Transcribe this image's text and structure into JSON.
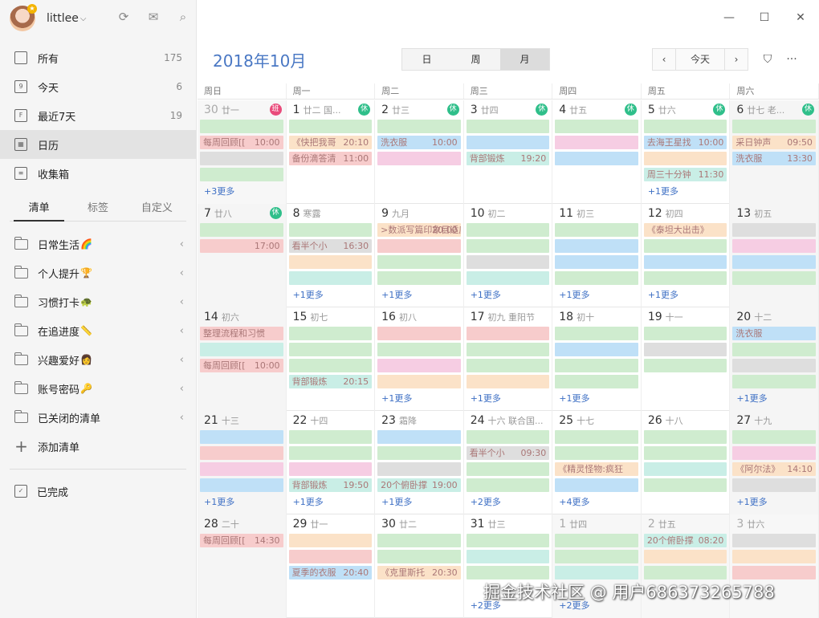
{
  "user": {
    "name": "littlee"
  },
  "nav": [
    {
      "label": "所有",
      "count": "175",
      "icon": "inbox-all-icon"
    },
    {
      "label": "今天",
      "count": "6",
      "icon": "calendar-today-icon"
    },
    {
      "label": "最近7天",
      "count": "19",
      "icon": "calendar-week-icon"
    },
    {
      "label": "日历",
      "count": "",
      "icon": "calendar-icon"
    },
    {
      "label": "收集箱",
      "count": "",
      "icon": "inbox-icon"
    }
  ],
  "list_tabs": [
    "清单",
    "标签",
    "自定义"
  ],
  "lists": [
    {
      "label": "日常生活",
      "emoji": "🌈"
    },
    {
      "label": "个人提升",
      "emoji": "🏆"
    },
    {
      "label": "习惯打卡",
      "emoji": "🐢"
    },
    {
      "label": "在追进度",
      "emoji": "📏"
    },
    {
      "label": "兴趣爱好",
      "emoji": "👩"
    },
    {
      "label": "账号密码",
      "emoji": "🔑"
    },
    {
      "label": "已关闭的清单",
      "emoji": ""
    }
  ],
  "add_list": "添加清单",
  "completed": "已完成",
  "header": {
    "month": "2018年10月",
    "views": [
      "日",
      "周",
      "月"
    ],
    "active_view": "月",
    "today": "今天",
    "prev": "‹",
    "next": "›"
  },
  "weekdays": [
    "周日",
    "周一",
    "周二",
    "周三",
    "周四",
    "周五",
    "周六"
  ],
  "colors": {
    "green": "#cfeccf",
    "red": "#f7cccc",
    "blue": "#bfe0f7",
    "pink": "#f6cde3",
    "orange": "#fbe2c8",
    "gray": "#dedede",
    "teal": "#c9eee6",
    "accent": "#4a78c4"
  },
  "weeks": [
    [
      {
        "num": "30",
        "lunar": "廿一",
        "badge": "班",
        "badge_type": "work",
        "other": true,
        "events": [
          {
            "text": "",
            "time": "",
            "color": "green"
          },
          {
            "text": "每周回顾[[",
            "time": "10:00",
            "color": "red"
          },
          {
            "text": "",
            "time": "",
            "color": "gray"
          },
          {
            "text": "",
            "time": "",
            "color": "green"
          }
        ],
        "more": "+3更多"
      },
      {
        "num": "1",
        "lunar": "廿二 国...",
        "badge": "休",
        "badge_type": "rest",
        "events": [
          {
            "text": "",
            "time": "",
            "color": "green"
          },
          {
            "text": "《快把我哥",
            "time": "20:10",
            "color": "orange"
          },
          {
            "text": "备份滴答清",
            "time": "11:00",
            "color": "red"
          }
        ]
      },
      {
        "num": "2",
        "lunar": "廿三",
        "badge": "休",
        "badge_type": "rest",
        "events": [
          {
            "text": "",
            "time": "",
            "color": "green"
          },
          {
            "text": "洗衣服",
            "time": "10:00",
            "color": "blue"
          },
          {
            "text": "",
            "time": "",
            "color": "pink"
          }
        ]
      },
      {
        "num": "3",
        "lunar": "廿四",
        "badge": "休",
        "badge_type": "rest",
        "events": [
          {
            "text": "",
            "time": "",
            "color": "green"
          },
          {
            "text": "",
            "time": "",
            "color": "blue"
          },
          {
            "text": "背部锻炼",
            "time": "19:20",
            "color": "teal"
          }
        ]
      },
      {
        "num": "4",
        "lunar": "廿五",
        "badge": "休",
        "badge_type": "rest",
        "events": [
          {
            "text": "",
            "time": "",
            "color": "green"
          },
          {
            "text": "",
            "time": "",
            "color": "pink"
          },
          {
            "text": "",
            "time": "",
            "color": "blue"
          }
        ]
      },
      {
        "num": "5",
        "lunar": "廿六",
        "badge": "休",
        "badge_type": "rest",
        "events": [
          {
            "text": "",
            "time": "",
            "color": "green"
          },
          {
            "text": "去海王星找",
            "time": "10:00",
            "color": "blue"
          },
          {
            "text": "",
            "time": "",
            "color": "orange"
          },
          {
            "text": "周三十分钟",
            "time": "11:30",
            "color": "teal"
          }
        ],
        "more": "+1更多"
      },
      {
        "num": "6",
        "lunar": "廿七 老...",
        "badge": "休",
        "badge_type": "rest",
        "events": [
          {
            "text": "",
            "time": "",
            "color": "green"
          },
          {
            "text": "采日钟声",
            "time": "09:50",
            "color": "orange"
          },
          {
            "text": "洗衣服",
            "time": "13:30",
            "color": "blue"
          }
        ]
      }
    ],
    [
      {
        "num": "7",
        "lunar": "廿八",
        "badge": "休",
        "badge_type": "rest",
        "events": [
          {
            "text": "",
            "time": "",
            "color": "green"
          },
          {
            "text": "",
            "time": "17:00",
            "color": "red"
          }
        ]
      },
      {
        "num": "8",
        "lunar": "寒露",
        "events": [
          {
            "text": "",
            "time": "",
            "color": "green"
          },
          {
            "text": "看半个小",
            "time": "16:30",
            "color": "gray"
          },
          {
            "text": "",
            "time": "",
            "color": "orange"
          },
          {
            "text": "",
            "time": "",
            "color": "teal"
          }
        ],
        "more": "+1更多"
      },
      {
        "num": "9",
        "lunar": "九月",
        "events": [
          {
            "text": ">数派写篇印象目适应的文章",
            "time": "20:00",
            "color": "orange"
          },
          {
            "text": "",
            "time": "",
            "color": "red"
          },
          {
            "text": "",
            "time": "",
            "color": "green"
          },
          {
            "text": "",
            "time": "",
            "color": "green"
          }
        ],
        "more": "+1更多"
      },
      {
        "num": "10",
        "lunar": "初二",
        "events": [
          {
            "text": "",
            "time": "",
            "color": "green"
          },
          {
            "text": "",
            "time": "",
            "color": "green"
          },
          {
            "text": "",
            "time": "",
            "color": "gray"
          },
          {
            "text": "",
            "time": "",
            "color": "teal"
          }
        ],
        "more": "+1更多"
      },
      {
        "num": "11",
        "lunar": "初三",
        "events": [
          {
            "text": "",
            "time": "",
            "color": "green"
          },
          {
            "text": "",
            "time": "",
            "color": "blue"
          },
          {
            "text": "",
            "time": "",
            "color": "blue"
          },
          {
            "text": "",
            "time": "",
            "color": "green"
          }
        ],
        "more": "+1更多"
      },
      {
        "num": "12",
        "lunar": "初四",
        "events": [
          {
            "text": "《泰坦大出击》",
            "time": "",
            "color": "orange"
          },
          {
            "text": "",
            "time": "",
            "color": "green"
          },
          {
            "text": "",
            "time": "",
            "color": "blue"
          },
          {
            "text": "",
            "time": "",
            "color": "green"
          }
        ],
        "more": "+1更多"
      },
      {
        "num": "13",
        "lunar": "初五",
        "events": [
          {
            "text": "",
            "time": "",
            "color": "gray"
          },
          {
            "text": "",
            "time": "",
            "color": "pink"
          },
          {
            "text": "",
            "time": "",
            "color": "blue"
          },
          {
            "text": "",
            "time": "",
            "color": "green"
          }
        ]
      }
    ],
    [
      {
        "num": "14",
        "lunar": "初六",
        "events": [
          {
            "text": "整理流程和习惯",
            "time": "",
            "color": "red"
          },
          {
            "text": "",
            "time": "",
            "color": "teal"
          },
          {
            "text": "每周回顾[[",
            "time": "10:00",
            "color": "red"
          }
        ]
      },
      {
        "num": "15",
        "lunar": "初七",
        "events": [
          {
            "text": "",
            "time": "",
            "color": "green"
          },
          {
            "text": "",
            "time": "",
            "color": "green"
          },
          {
            "text": "",
            "time": "",
            "color": "green"
          },
          {
            "text": "背部锻炼",
            "time": "20:15",
            "color": "teal"
          }
        ]
      },
      {
        "num": "16",
        "lunar": "初八",
        "events": [
          {
            "text": "",
            "time": "",
            "color": "red"
          },
          {
            "text": "",
            "time": "",
            "color": "green"
          },
          {
            "text": "",
            "time": "",
            "color": "pink"
          },
          {
            "text": "",
            "time": "",
            "color": "orange"
          }
        ],
        "more": "+1更多"
      },
      {
        "num": "17",
        "lunar": "初九 重阳节",
        "events": [
          {
            "text": "",
            "time": "",
            "color": "red"
          },
          {
            "text": "",
            "time": "",
            "color": "green"
          },
          {
            "text": "",
            "time": "",
            "color": "green"
          },
          {
            "text": "",
            "time": "",
            "color": "orange"
          }
        ],
        "more": "+1更多"
      },
      {
        "num": "18",
        "lunar": "初十",
        "events": [
          {
            "text": "",
            "time": "",
            "color": "green"
          },
          {
            "text": "",
            "time": "",
            "color": "blue"
          },
          {
            "text": "",
            "time": "",
            "color": "green"
          },
          {
            "text": "",
            "time": "",
            "color": "green"
          }
        ],
        "more": "+1更多"
      },
      {
        "num": "19",
        "lunar": "十一",
        "events": [
          {
            "text": "",
            "time": "",
            "color": "green"
          },
          {
            "text": "",
            "time": "",
            "color": "gray"
          },
          {
            "text": "",
            "time": "",
            "color": "green"
          }
        ]
      },
      {
        "num": "20",
        "lunar": "十二",
        "events": [
          {
            "text": "洗衣服",
            "time": "",
            "color": "blue"
          },
          {
            "text": "",
            "time": "",
            "color": "green"
          },
          {
            "text": "",
            "time": "",
            "color": "gray"
          },
          {
            "text": "",
            "time": "",
            "color": "green"
          }
        ],
        "more": "+1更多"
      }
    ],
    [
      {
        "num": "21",
        "lunar": "十三",
        "events": [
          {
            "text": "",
            "time": "",
            "color": "blue"
          },
          {
            "text": "",
            "time": "",
            "color": "red"
          },
          {
            "text": "",
            "time": "",
            "color": "pink"
          },
          {
            "text": "",
            "time": "",
            "color": "blue"
          }
        ],
        "more": "+1更多"
      },
      {
        "num": "22",
        "lunar": "十四",
        "events": [
          {
            "text": "",
            "time": "",
            "color": "green"
          },
          {
            "text": "",
            "time": "",
            "color": "green"
          },
          {
            "text": "",
            "time": "",
            "color": "pink"
          },
          {
            "text": "背部锻炼",
            "time": "19:50",
            "color": "teal"
          }
        ],
        "more": "+1更多"
      },
      {
        "num": "23",
        "lunar": "霜降",
        "events": [
          {
            "text": "",
            "time": "",
            "color": "blue"
          },
          {
            "text": "",
            "time": "",
            "color": "green"
          },
          {
            "text": "",
            "time": "",
            "color": "gray"
          },
          {
            "text": "20个俯卧撑",
            "time": "19:00",
            "color": "teal"
          }
        ],
        "more": "+1更多"
      },
      {
        "num": "24",
        "lunar": "十六 联合国...",
        "events": [
          {
            "text": "",
            "time": "",
            "color": "green"
          },
          {
            "text": "看半个小",
            "time": "09:30",
            "color": "gray"
          },
          {
            "text": "",
            "time": "",
            "color": "green"
          },
          {
            "text": "",
            "time": "",
            "color": "green"
          }
        ],
        "more": "+2更多"
      },
      {
        "num": "25",
        "lunar": "十七",
        "events": [
          {
            "text": "",
            "time": "",
            "color": "green"
          },
          {
            "text": "",
            "time": "",
            "color": "green"
          },
          {
            "text": "《精灵怪物:疯狂",
            "time": "",
            "color": "orange"
          },
          {
            "text": "",
            "time": "",
            "color": "blue"
          }
        ],
        "more": "+4更多"
      },
      {
        "num": "26",
        "lunar": "十八",
        "events": [
          {
            "text": "",
            "time": "",
            "color": "green"
          },
          {
            "text": "",
            "time": "",
            "color": "green"
          },
          {
            "text": "",
            "time": "",
            "color": "teal"
          },
          {
            "text": "",
            "time": "",
            "color": "green"
          }
        ]
      },
      {
        "num": "27",
        "lunar": "十九",
        "events": [
          {
            "text": "",
            "time": "",
            "color": "green"
          },
          {
            "text": "",
            "time": "",
            "color": "pink"
          },
          {
            "text": "《阿尔法》",
            "time": "14:10",
            "color": "orange"
          },
          {
            "text": "",
            "time": "",
            "color": "gray"
          }
        ],
        "more": "+1更多"
      }
    ],
    [
      {
        "num": "28",
        "lunar": "二十",
        "events": [
          {
            "text": "每周回顾[[",
            "time": "14:30",
            "color": "red"
          }
        ]
      },
      {
        "num": "29",
        "lunar": "廿一",
        "events": [
          {
            "text": "",
            "time": "",
            "color": "orange"
          },
          {
            "text": "",
            "time": "",
            "color": "red"
          },
          {
            "text": "夏季的衣服",
            "time": "20:40",
            "color": "blue"
          }
        ]
      },
      {
        "num": "30",
        "lunar": "廿二",
        "events": [
          {
            "text": "",
            "time": "",
            "color": "green"
          },
          {
            "text": "",
            "time": "",
            "color": "green"
          },
          {
            "text": "《克里斯托",
            "time": "20:30",
            "color": "orange"
          }
        ]
      },
      {
        "num": "31",
        "lunar": "廿三",
        "events": [
          {
            "text": "",
            "time": "",
            "color": "green"
          },
          {
            "text": "",
            "time": "",
            "color": "teal"
          },
          {
            "text": "",
            "time": "",
            "color": "green"
          }
        ],
        "more": "+2更多"
      },
      {
        "num": "1",
        "lunar": "廿四",
        "other": true,
        "events": [
          {
            "text": "",
            "time": "",
            "color": "green"
          },
          {
            "text": "",
            "time": "",
            "color": "green"
          },
          {
            "text": "",
            "time": "",
            "color": "teal"
          }
        ],
        "more": "+2更多"
      },
      {
        "num": "2",
        "lunar": "廿五",
        "other": true,
        "events": [
          {
            "text": "20个俯卧撑",
            "time": "08:20",
            "color": "teal"
          },
          {
            "text": "",
            "time": "",
            "color": "orange"
          },
          {
            "text": "",
            "time": "",
            "color": "green"
          }
        ]
      },
      {
        "num": "3",
        "lunar": "廿六",
        "other": true,
        "events": [
          {
            "text": "",
            "time": "",
            "color": "gray"
          },
          {
            "text": "",
            "time": "",
            "color": "orange"
          },
          {
            "text": "",
            "time": "",
            "color": "red"
          }
        ]
      }
    ]
  ],
  "watermark": "掘金技术社区 @ 用户686373265788"
}
